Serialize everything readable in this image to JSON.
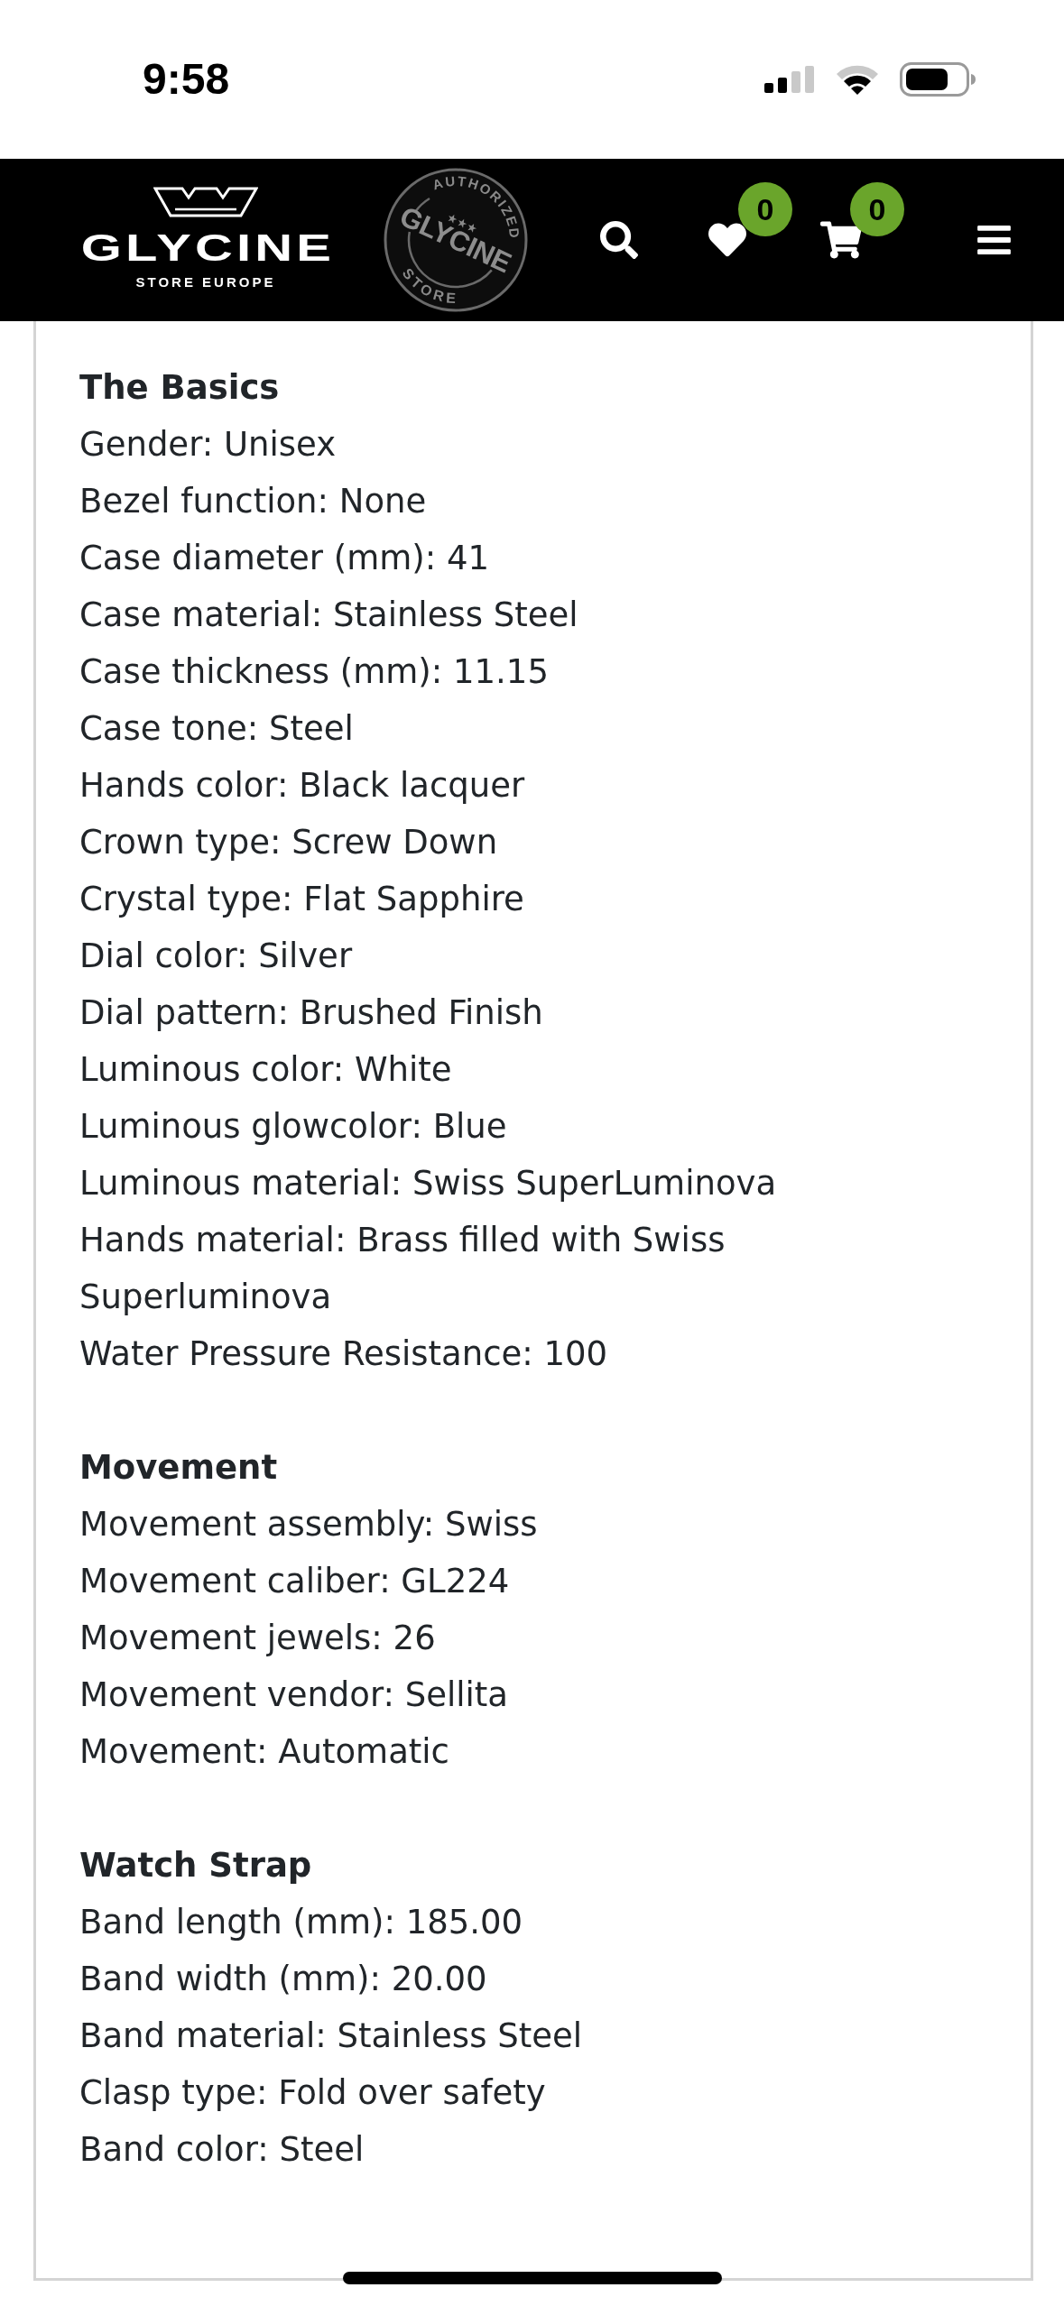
{
  "status_bar": {
    "time": "9:58"
  },
  "header": {
    "logo": {
      "wordmark": "GLYCINE",
      "tagline": "STORE EUROPE"
    },
    "stamp": {
      "top_text": "AUTHORIZED",
      "center_text": "GLYCINE",
      "bottom_text": "STORE"
    },
    "wishlist": {
      "count": "0"
    },
    "cart": {
      "count": "0"
    }
  },
  "sections": [
    {
      "title": "The Basics",
      "lines": [
        "Gender: Unisex",
        "Bezel function: None",
        "Case diameter (mm): 41",
        "Case material: Stainless Steel",
        "Case thickness (mm): 11.15",
        "Case tone: Steel",
        "Hands color: Black lacquer",
        "Crown type: Screw Down",
        "Crystal type: Flat Sapphire",
        "Dial color: Silver",
        "Dial pattern: Brushed Finish",
        "Luminous color: White",
        "Luminous glowcolor: Blue",
        "Luminous material: Swiss SuperLuminova",
        "Hands material: Brass filled with Swiss Superluminova",
        "Water Pressure Resistance: 100"
      ]
    },
    {
      "title": "Movement",
      "lines": [
        "Movement assembly: Swiss",
        "Movement caliber: GL224",
        "Movement jewels: 26",
        "Movement vendor: Sellita",
        "Movement: Automatic"
      ]
    },
    {
      "title": "Watch Strap",
      "lines": [
        "Band length (mm): 185.00",
        "Band width (mm): 20.00",
        "Band material: Stainless Steel",
        "Clasp type: Fold over safety",
        "Band color: Steel"
      ]
    }
  ]
}
